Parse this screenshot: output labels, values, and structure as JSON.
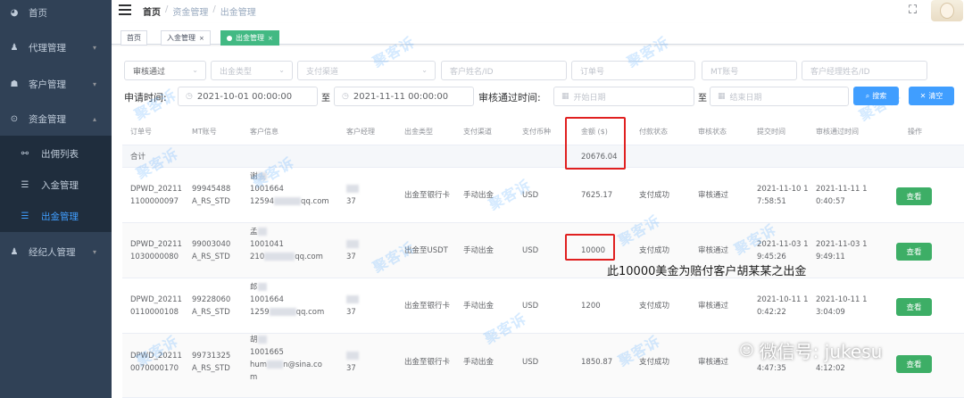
{
  "sidebar": {
    "items": [
      {
        "label": "首页",
        "icon": "dashboard-icon"
      },
      {
        "label": "代理管理",
        "icon": "agent-icon"
      },
      {
        "label": "客户管理",
        "icon": "user-icon"
      },
      {
        "label": "资金管理",
        "icon": "fund-icon"
      },
      {
        "label": "经纪人管理",
        "icon": "broker-icon"
      }
    ],
    "sub_items": [
      {
        "label": "出佣列表",
        "icon": "tree-icon"
      },
      {
        "label": "入金管理",
        "icon": "list-icon"
      },
      {
        "label": "出金管理",
        "icon": "list-icon"
      }
    ],
    "arrow_down": "▾",
    "arrow_up": "▴"
  },
  "navbar": {
    "breadcrumb": [
      "首页",
      "资金管理",
      "出金管理"
    ],
    "separator": "/"
  },
  "tags": [
    {
      "label": "首页",
      "active": false,
      "close": ""
    },
    {
      "label": "入金管理",
      "active": false,
      "close": "×"
    },
    {
      "label": "出金管理",
      "active": true,
      "close": "×"
    }
  ],
  "filters": {
    "review_status": "审核通过",
    "withdraw_type_placeholder": "出金类型",
    "pay_channel_placeholder": "支付渠道",
    "customer_name_placeholder": "客户姓名/ID",
    "order_no_placeholder": "订单号",
    "mt_account_placeholder": "MT账号",
    "manager_placeholder": "客户经理姓名/ID",
    "apply_time_label": "申请时间:",
    "apply_start": "2021-10-01 00:00:00",
    "apply_end": "2021-11-11 00:00:00",
    "range_separator": "至",
    "review_time_label": "审核通过时间:",
    "review_start_placeholder": "开始日期",
    "review_end_placeholder": "结束日期",
    "search_label": "搜索",
    "clear_label": "清空"
  },
  "table": {
    "headers": [
      "订单号",
      "MT账号",
      "客户信息",
      "客户经理",
      "出金类型",
      "支付渠道",
      "支付币种",
      "金额 ($)",
      "付款状态",
      "审核状态",
      "提交时间",
      "审核通过时间",
      "操作"
    ],
    "sum_label": "合计",
    "sum_amount": "20676.04",
    "action_label": "查看",
    "rows": [
      {
        "order1": "DPWD_20211",
        "order2": "1100000097",
        "mt1": "99945488",
        "mt2": "A_RS_STD",
        "c1": "谢",
        "c2": "1001664",
        "c3a": "12594",
        "c3b": "qq.com",
        "mgr": "37",
        "type": "出金至银行卡",
        "channel": "手动出金",
        "currency": "USD",
        "amount": "7625.17",
        "pay_status": "支付成功",
        "review_status": "审核通过",
        "submit1": "2021-11-10 1",
        "submit2": "7:58:51",
        "approve1": "2021-11-11 1",
        "approve2": "0:40:57"
      },
      {
        "order1": "DPWD_20211",
        "order2": "1030000080",
        "mt1": "99003040",
        "mt2": "A_RS_STD",
        "c1": "孟",
        "c2": "1001041",
        "c3a": "210",
        "c3b": "qq.com",
        "mgr": "37",
        "type": "出金至USDT",
        "channel": "手动出金",
        "currency": "USD",
        "amount": "10000",
        "pay_status": "支付成功",
        "review_status": "审核通过",
        "submit1": "2021-11-03 1",
        "submit2": "9:45:26",
        "approve1": "2021-11-03 1",
        "approve2": "9:49:11"
      },
      {
        "order1": "DPWD_20211",
        "order2": "0110000108",
        "mt1": "99228060",
        "mt2": "A_RS_STD",
        "c1": "郎",
        "c2": "1001664",
        "c3a": "1259",
        "c3b": "qq.com",
        "mgr": "37",
        "type": "出金至银行卡",
        "channel": "手动出金",
        "currency": "USD",
        "amount": "1200",
        "pay_status": "支付成功",
        "review_status": "审核通过",
        "submit1": "2021-10-11 1",
        "submit2": "0:42:22",
        "approve1": "2021-10-11 1",
        "approve2": "3:04:09"
      },
      {
        "order1": "DPWD_20211",
        "order2": "0070000170",
        "mt1": "99731325",
        "mt2": "A_RS_STD",
        "c1": "胡",
        "c2": "1001665",
        "c3a": "hum",
        "c3b": "n@sina.co",
        "c4": "m",
        "mgr": "37",
        "type": "出金至银行卡",
        "channel": "手动出金",
        "currency": "USD",
        "amount": "1850.87",
        "pay_status": "支付成功",
        "review_status": "审核通过",
        "submit1": "",
        "submit2": "4:47:35",
        "approve1": "",
        "approve2": "4:12:02"
      }
    ]
  },
  "annotation": "此10000美金为赔付客户胡某某之出金",
  "watermark": "聚客诉",
  "wechat": "微信号: jukesu",
  "colors": {
    "sidebar_bg": "#304156",
    "active": "#409eff",
    "tag_active": "#42b983",
    "view_btn": "#3dae66",
    "highlight": "#e02020"
  }
}
